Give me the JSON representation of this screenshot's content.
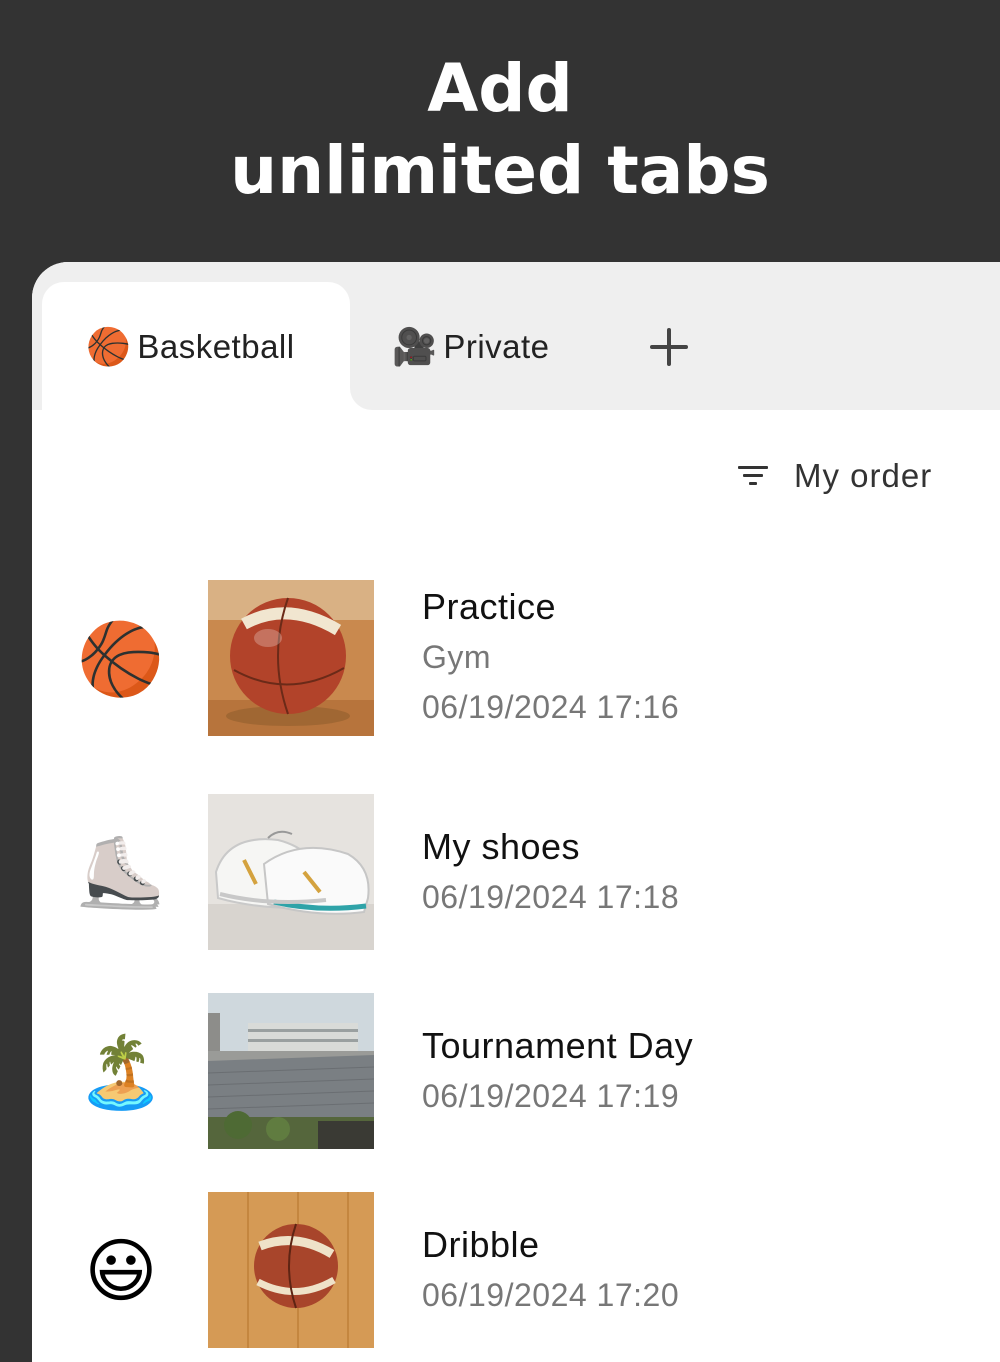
{
  "headline": {
    "line1": "Add",
    "line2": "unlimited tabs"
  },
  "tabs": [
    {
      "icon": "🏀",
      "label": "Basketball",
      "active": true
    },
    {
      "icon": "🎥",
      "label": "Private",
      "active": false
    }
  ],
  "add_tab_icon": "plus-icon",
  "sort": {
    "label": "My order",
    "icon": "filter-icon"
  },
  "items": [
    {
      "emoji": "🏀",
      "title": "Practice",
      "subtitle": "Gym",
      "date": "06/19/2024 17:16",
      "photo": "basketball photo"
    },
    {
      "emoji": "⛸️",
      "title": "My shoes",
      "date": "06/19/2024 17:18",
      "photo": "sneakers photo"
    },
    {
      "emoji": "🏝️",
      "title": "Tournament Day",
      "date": "06/19/2024 17:19",
      "photo": "rooftop photo"
    },
    {
      "emoji": "😃",
      "title": "Dribble",
      "date": "06/19/2024 17:20",
      "photo": "basketball on wood photo"
    }
  ],
  "colors": {
    "background": "#333333",
    "tabbar": "#efefef",
    "card": "#ffffff",
    "secondary_text": "#777777"
  }
}
